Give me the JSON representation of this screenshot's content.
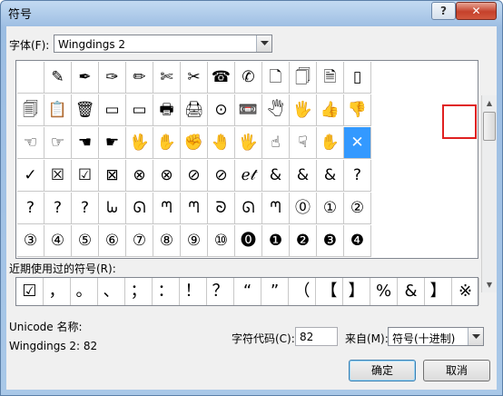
{
  "dialog": {
    "title": "符号"
  },
  "titlebar": {
    "help_label": "?",
    "close_label": "✕"
  },
  "font": {
    "label": "字体(F):",
    "value": "Wingdings 2"
  },
  "symbols": [
    [
      "",
      "✎",
      "✒",
      "✑",
      "✏",
      "✄",
      "✂",
      "☎",
      "✆",
      "🗋",
      "🗍",
      "🗎",
      "▯"
    ],
    [
      "🗐",
      "📋",
      "🗑",
      "▭",
      "▭",
      "🖶",
      "🖨",
      "⊙",
      "📼",
      "🖑",
      "🖐",
      "👍",
      "👎"
    ],
    [
      "☜",
      "☞",
      "☚",
      "☛",
      "🖖",
      "✋",
      "✊",
      "🤚",
      "🖐",
      "☝",
      "☟",
      "✋",
      "✕"
    ],
    [
      "✓",
      "☒",
      "☑",
      "⊠",
      "⊗",
      "⊗",
      "⊘",
      "⊘",
      "ℯ𝓉",
      "&",
      "&",
      "&",
      "?"
    ],
    [
      "?",
      "?",
      "?",
      "ᘈ",
      "ᘏ",
      "ᘉ",
      "ᘉ",
      "ᘐ",
      "ᘏ",
      "ᘉ",
      "⓪",
      "①",
      "②"
    ],
    [
      "③",
      "④",
      "⑤",
      "⑥",
      "⑦",
      "⑧",
      "⑨",
      "⑩",
      "⓿",
      "❶",
      "❷",
      "❸",
      "❹"
    ]
  ],
  "recent_label": "近期使用过的符号(R):",
  "recent_symbols": [
    "☑",
    "，",
    "。",
    "、",
    "；",
    "：",
    "！",
    "？",
    "“",
    "”",
    "（",
    "【",
    "】",
    "%",
    "&",
    "】",
    "※"
  ],
  "unicode_name_label": "Unicode 名称:",
  "char_name": "Wingdings 2: 82",
  "char_code": {
    "label": "字符代码(C):",
    "value": "82"
  },
  "from": {
    "label": "来自(M):",
    "value": "符号(十进制)"
  },
  "buttons": {
    "ok": "确定",
    "cancel": "取消"
  }
}
